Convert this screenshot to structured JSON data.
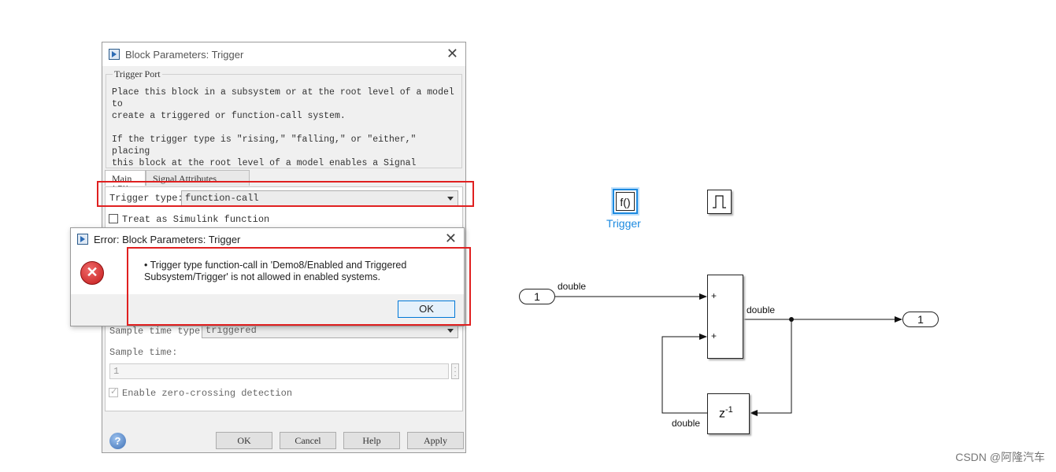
{
  "block_dialog": {
    "title": "Block Parameters: Trigger",
    "group_title": "Trigger Port",
    "description": "Place this block in a subsystem or at the root level of a model to\ncreate a triggered or function-call system.\n\nIf the trigger type is \"rising,\" \"falling,\" or \"either,\" placing\nthis block at the root level of a model enables a Signal Attributes\ntab.",
    "tabs": [
      "Main",
      "Signal Attributes"
    ],
    "trigger_type_label": "Trigger type:",
    "trigger_type_value": "function-call",
    "treat_as_function_label": "Treat as Simulink function",
    "sample_time_type_label": "Sample time type:",
    "sample_time_type_value": "triggered",
    "sample_time_label": "Sample time:",
    "sample_time_value": "1",
    "zero_crossing_label": "Enable zero-crossing detection",
    "buttons": {
      "ok": "OK",
      "cancel": "Cancel",
      "help": "Help",
      "apply": "Apply"
    }
  },
  "error_dialog": {
    "title": "Error: Block Parameters: Trigger",
    "message": "• Trigger type function-call in 'Demo8/Enabled and Triggered Subsystem/Trigger' is not allowed in enabled systems.",
    "ok": "OK"
  },
  "diagram": {
    "function_block_label": "f()",
    "trigger_label": "Trigger",
    "inport_number": "1",
    "outport_number": "1",
    "signal_in_type": "double",
    "signal_out_type": "double",
    "feedback_type": "double",
    "sum_signs": [
      "+",
      "+"
    ],
    "delay_label": "z",
    "delay_exponent": "-1",
    "colors": {
      "trigger_accent": "#1c8ae0",
      "highlight_red": "#e02020"
    }
  },
  "watermark": "CSDN @阿隆汽车"
}
